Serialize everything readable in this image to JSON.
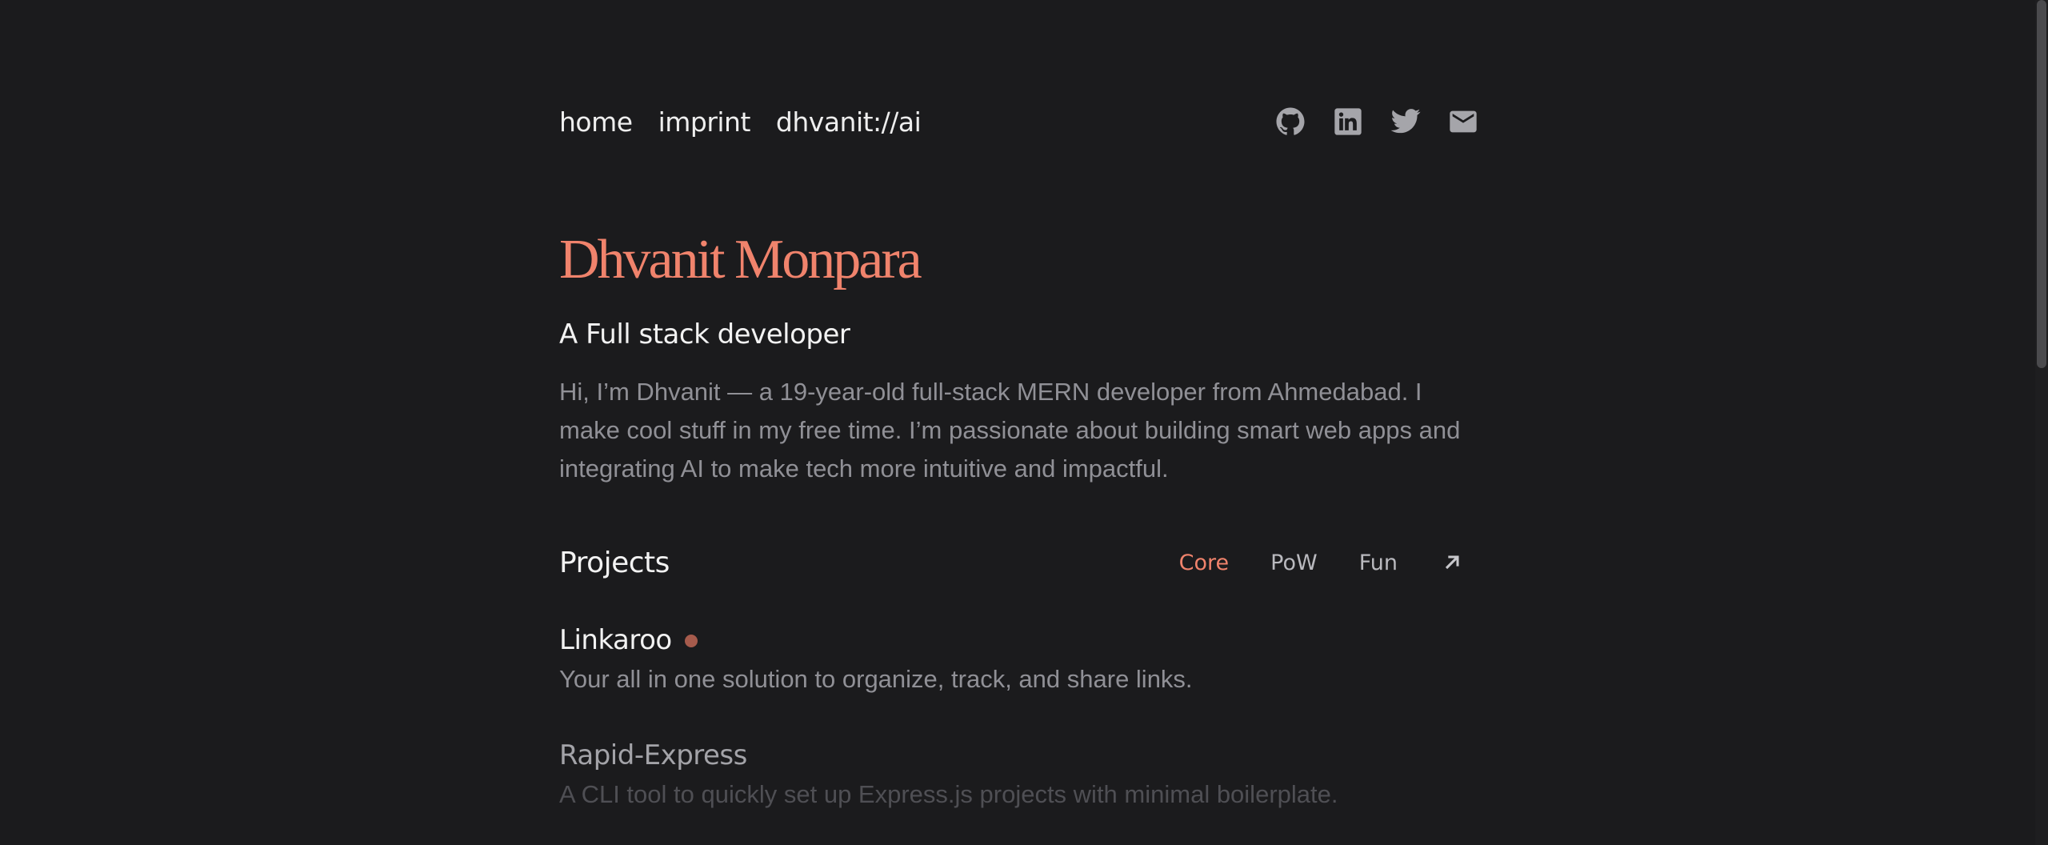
{
  "nav": {
    "links": [
      "home",
      "imprint",
      "dhvanit://ai"
    ]
  },
  "social": {
    "icons": [
      "github-icon",
      "linkedin-icon",
      "twitter-icon",
      "mail-icon"
    ],
    "color": "#a5a5aa"
  },
  "hero": {
    "name": "Dhvanit Monpara",
    "tagline": "A Full stack developer",
    "bio": "Hi, I’m Dhvanit — a 19-year-old full-stack MERN developer from Ahmedabad. I make cool stuff in my free time. I’m passionate about building smart web apps and integrating AI to make tech more intuitive and impactful."
  },
  "projects": {
    "title": "Projects",
    "filters": [
      "Core",
      "PoW",
      "Fun"
    ],
    "active_filter": "Core",
    "external_link_icon": "arrow-up-right-icon",
    "items": [
      {
        "name": "Linkaroo",
        "description": "Your all in one solution to organize, track, and share links."
      },
      {
        "name": "Rapid-Express",
        "description": "A CLI tool to quickly set up Express.js projects with minimal boilerplate."
      }
    ]
  },
  "colors": {
    "background": "#1b1b1d",
    "accent": "#f0836c",
    "status_dot": "#a65b4c"
  }
}
